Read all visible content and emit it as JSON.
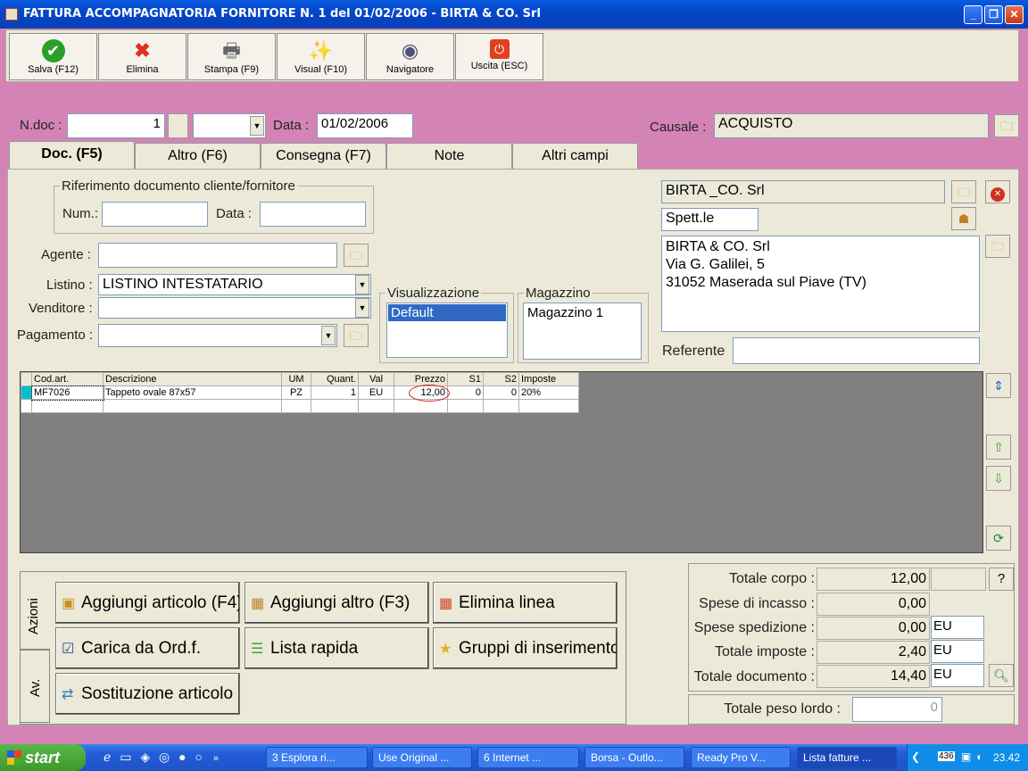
{
  "window": {
    "title": "FATTURA ACCOMPAGNATORIA FORNITORE N. 1  del 01/02/2006 - BIRTA & CO. Srl"
  },
  "toolbar": [
    {
      "label": "Salva (F12)",
      "icon": "check-icon"
    },
    {
      "label": "Elimina",
      "icon": "x-icon"
    },
    {
      "label": "Stampa (F9)",
      "icon": "printer-icon"
    },
    {
      "label": "Visual (F10)",
      "icon": "wand-icon"
    },
    {
      "label": "Navigatore",
      "icon": "compass-icon"
    },
    {
      "label": "Uscita (ESC)",
      "icon": "power-icon"
    }
  ],
  "header": {
    "ndoc_label": "N.doc :",
    "ndoc_value": "1",
    "data_label": "Data :",
    "data_value": "01/02/2006",
    "causale_label": "Causale :",
    "causale_value": "ACQUISTO"
  },
  "tabs": [
    "Doc. (F5)",
    "Altro (F6)",
    "Consegna (F7)",
    "Note",
    "Altri campi"
  ],
  "riferimento": {
    "legend": "Riferimento documento cliente/fornitore",
    "num_label": "Num.:",
    "num_value": "",
    "data_label": "Data :",
    "data_value": ""
  },
  "fields": {
    "agente_label": "Agente :",
    "agente_value": "",
    "listino_label": "Listino :",
    "listino_value": "LISTINO INTESTATARIO",
    "venditore_label": "Venditore :",
    "venditore_value": "",
    "pagamento_label": "Pagamento :",
    "pagamento_value": ""
  },
  "visualizzazione": {
    "legend": "Visualizzazione",
    "selected": "Default"
  },
  "magazzino": {
    "legend": "Magazzino",
    "value": "Magazzino 1"
  },
  "customer": {
    "name": "BIRTA _CO. Srl",
    "salutation": "Spett.le",
    "address_lines": [
      "BIRTA & CO. Srl",
      "Via G. Galilei, 5",
      "31052 Maserada sul Piave (TV)"
    ],
    "referente_label": "Referente",
    "referente_value": ""
  },
  "grid": {
    "columns": [
      "Cod.art.",
      "Descrizione",
      "UM",
      "Quant.",
      "Val",
      "Prezzo",
      "S1",
      "S2",
      "Imposte"
    ],
    "rows": [
      [
        "MF7026",
        "Tappeto ovale 87x57",
        "PZ",
        "1",
        "EU",
        "12,00",
        "0",
        "0",
        "20%"
      ],
      [
        "",
        "",
        "",
        "",
        "",
        "",
        "",
        "",
        ""
      ]
    ]
  },
  "side_tabs": [
    "Azioni",
    "Av."
  ],
  "actions": [
    {
      "label": "Aggiungi articolo (F4)",
      "icon": "box-add-icon"
    },
    {
      "label": "Aggiungi altro (F3)",
      "icon": "grid-add-icon"
    },
    {
      "label": "Elimina linea",
      "icon": "grid-delete-icon"
    },
    {
      "label": "Carica da Ord.f.",
      "icon": "checklist-icon"
    },
    {
      "label": "Lista rapida",
      "icon": "list-add-icon"
    },
    {
      "label": "Gruppi di inserimento",
      "icon": "star-add-icon"
    },
    {
      "label": "Sostituzione articolo",
      "icon": "swap-icon"
    }
  ],
  "totals": {
    "corpo_label": "Totale corpo :",
    "corpo_value": "12,00",
    "incasso_label": "Spese di incasso :",
    "incasso_value": "0,00",
    "spedizione_label": "Spese spedizione :",
    "spedizione_value": "0,00",
    "spedizione_cur": "EU",
    "imposte_label": "Totale imposte :",
    "imposte_value": "2,40",
    "imposte_cur": "EU",
    "documento_label": "Totale documento :",
    "documento_value": "14,40",
    "documento_cur": "EU",
    "peso_label": "Totale peso lordo :",
    "peso_value": "0",
    "help": "?"
  },
  "taskbar": {
    "start": "start",
    "tasks": [
      "3 Esplora ri...",
      "Use Original ...",
      "6 Internet ...",
      "Borsa - Outlo...",
      "Ready Pro V...",
      "Lista fatture ..."
    ],
    "tray_number": "436",
    "clock": "23.42"
  },
  "colors": {
    "background": "#d484b4",
    "panel": "#ece9d8",
    "titlebar": "#0a4fd0",
    "selected": "#316ac5"
  }
}
